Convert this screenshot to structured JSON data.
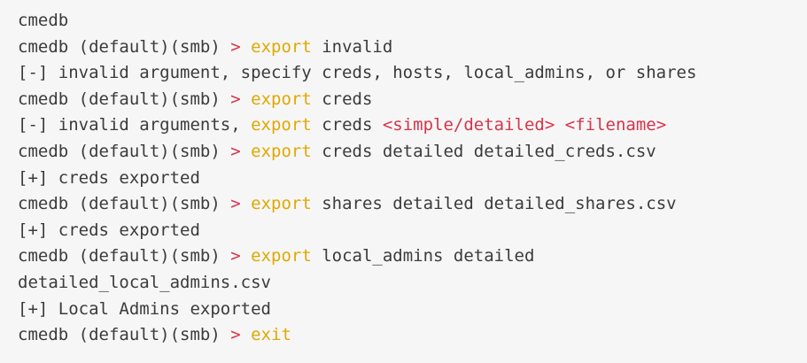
{
  "colors": {
    "background": "#f6f6f6",
    "text": "#3b3b3b",
    "operator": "#d7344b",
    "keyword": "#e0a800",
    "placeholder": "#d7344b"
  },
  "lines": [
    [
      {
        "t": "cmedb",
        "c": "plain"
      }
    ],
    [
      {
        "t": "cmedb (default)(smb) ",
        "c": "plain"
      },
      {
        "t": ">",
        "c": "op"
      },
      {
        "t": " ",
        "c": "plain"
      },
      {
        "t": "export",
        "c": "kw"
      },
      {
        "t": " invalid",
        "c": "plain"
      }
    ],
    [
      {
        "t": "[-] invalid argument, specify creds, hosts, local_admins, or shares",
        "c": "plain"
      }
    ],
    [
      {
        "t": "cmedb (default)(smb) ",
        "c": "plain"
      },
      {
        "t": ">",
        "c": "op"
      },
      {
        "t": " ",
        "c": "plain"
      },
      {
        "t": "export",
        "c": "kw"
      },
      {
        "t": " creds",
        "c": "plain"
      }
    ],
    [
      {
        "t": "[-] invalid arguments, ",
        "c": "plain"
      },
      {
        "t": "export",
        "c": "kw"
      },
      {
        "t": " creds ",
        "c": "plain"
      },
      {
        "t": "<simple/detailed>",
        "c": "tag"
      },
      {
        "t": " ",
        "c": "plain"
      },
      {
        "t": "<filename>",
        "c": "tag"
      }
    ],
    [
      {
        "t": "cmedb (default)(smb) ",
        "c": "plain"
      },
      {
        "t": ">",
        "c": "op"
      },
      {
        "t": " ",
        "c": "plain"
      },
      {
        "t": "export",
        "c": "kw"
      },
      {
        "t": " creds detailed detailed_creds.csv",
        "c": "plain"
      }
    ],
    [
      {
        "t": "[+] creds exported",
        "c": "plain"
      }
    ],
    [
      {
        "t": "cmedb (default)(smb) ",
        "c": "plain"
      },
      {
        "t": ">",
        "c": "op"
      },
      {
        "t": " ",
        "c": "plain"
      },
      {
        "t": "export",
        "c": "kw"
      },
      {
        "t": " shares detailed detailed_shares.csv",
        "c": "plain"
      }
    ],
    [
      {
        "t": "[+] creds exported",
        "c": "plain"
      }
    ],
    [
      {
        "t": "cmedb (default)(smb) ",
        "c": "plain"
      },
      {
        "t": ">",
        "c": "op"
      },
      {
        "t": " ",
        "c": "plain"
      },
      {
        "t": "export",
        "c": "kw"
      },
      {
        "t": " local_admins detailed",
        "c": "plain"
      }
    ],
    [
      {
        "t": "detailed_local_admins.csv",
        "c": "plain"
      }
    ],
    [
      {
        "t": "[+] Local Admins exported",
        "c": "plain"
      }
    ],
    [
      {
        "t": "cmedb (default)(smb) ",
        "c": "plain"
      },
      {
        "t": ">",
        "c": "op"
      },
      {
        "t": " ",
        "c": "plain"
      },
      {
        "t": "exit",
        "c": "kw"
      }
    ]
  ]
}
